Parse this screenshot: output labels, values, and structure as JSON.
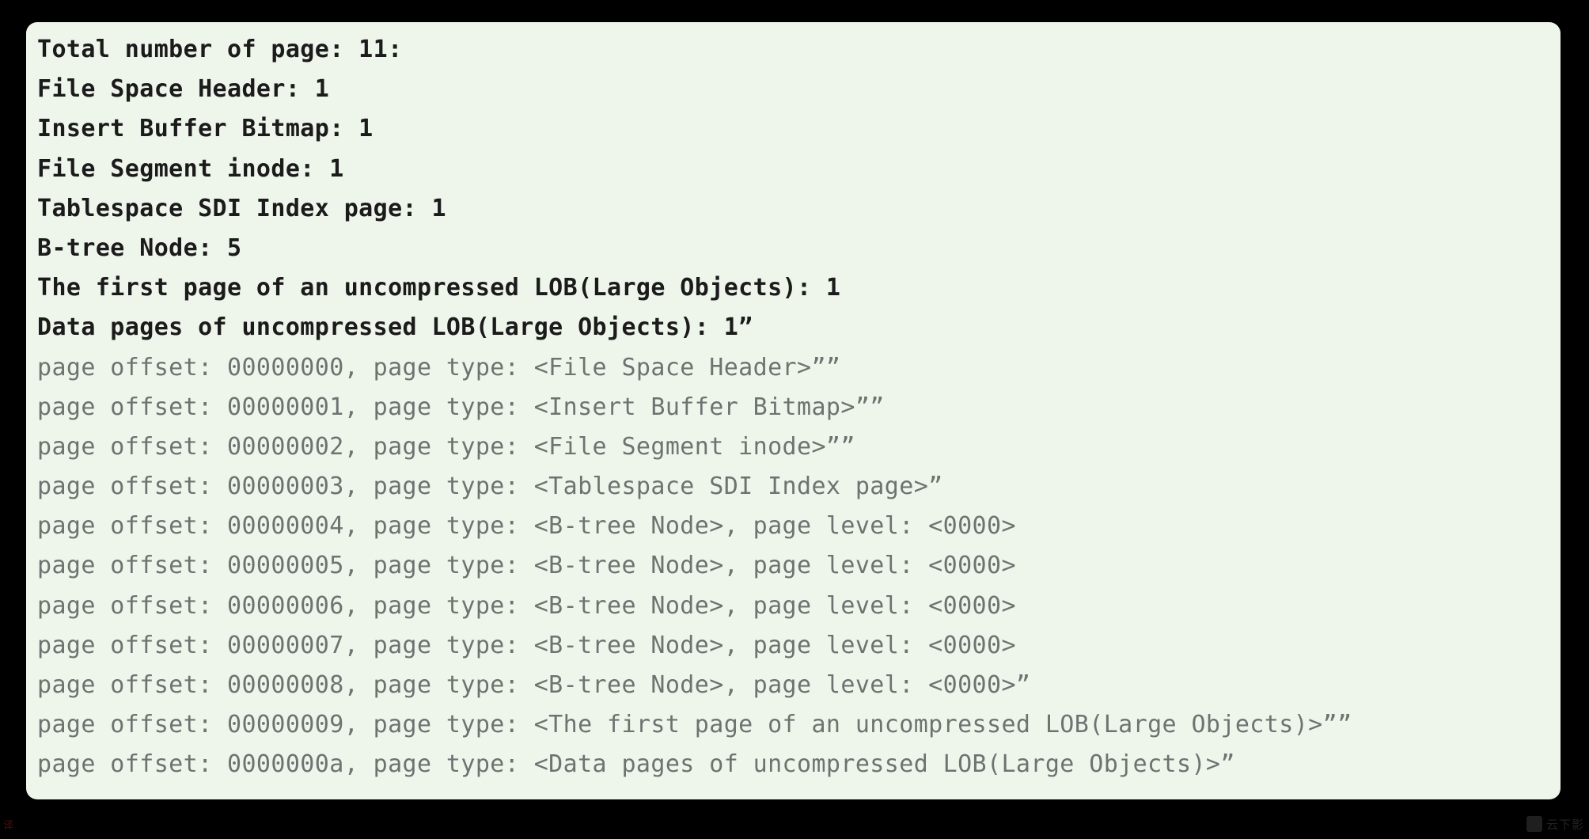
{
  "console": {
    "summary_lines": [
      "Total number of page: 11:",
      "File Space Header: 1",
      "Insert Buffer Bitmap: 1",
      "File Segment inode: 1",
      "Tablespace SDI Index page: 1",
      "B-tree Node: 5",
      "The first page of an uncompressed LOB(Large Objects): 1",
      "Data pages of uncompressed LOB(Large Objects): 1”"
    ],
    "detail_lines": [
      "page offset: 00000000, page type: <File Space Header>””",
      "page offset: 00000001, page type: <Insert Buffer Bitmap>””",
      "page offset: 00000002, page type: <File Segment inode>””",
      "page offset: 00000003, page type: <Tablespace SDI Index page>”",
      "page offset: 00000004, page type: <B-tree Node>, page level: <0000>",
      "page offset: 00000005, page type: <B-tree Node>, page level: <0000>",
      "page offset: 00000006, page type: <B-tree Node>, page level: <0000>",
      "page offset: 00000007, page type: <B-tree Node>, page level: <0000>",
      "page offset: 00000008, page type: <B-tree Node>, page level: <0000>”",
      "page offset: 00000009, page type: <The first page of an uncompressed LOB(Large Objects)>””",
      "page offset: 0000000a, page type: <Data pages of uncompressed LOB(Large Objects)>”"
    ],
    "page_counts": {
      "total_pages": "11",
      "file_space_header": "1",
      "insert_buffer_bitmap": "1",
      "file_segment_inode": "1",
      "tablespace_sdi_index_page": "1",
      "b_tree_node": "5",
      "lob_first_page": "1",
      "lob_data_pages": "1"
    },
    "colors": {
      "panel_background": "#eef6ec",
      "screen_background": "#000000",
      "summary_text": "#1b1b1b",
      "detail_text": "#6d7370"
    }
  },
  "artifacts": {
    "corner_mark": "译",
    "watermark_text": "云下影"
  }
}
